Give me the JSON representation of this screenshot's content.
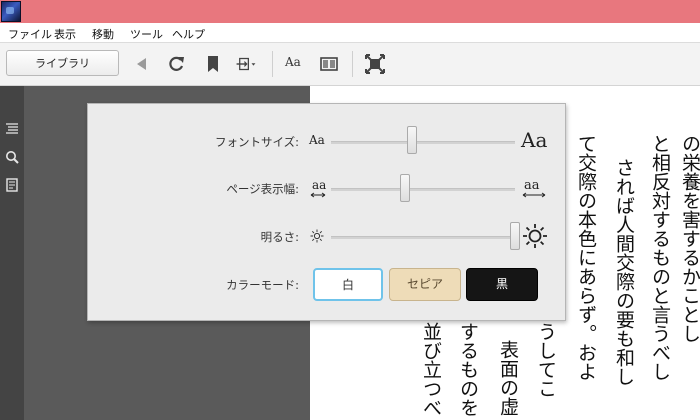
{
  "menu": [
    "ファイル",
    "表示",
    "移動",
    "ツール",
    "ヘルプ"
  ],
  "toolbar": {
    "library_label": "ライブラリ",
    "font_button": "Aa"
  },
  "settings": {
    "font_size": {
      "label": "フォントサイズ:",
      "min_glyph": "Aa",
      "max_glyph": "Aa",
      "level": 0.44
    },
    "page_width": {
      "label": "ページ表示幅:",
      "min_glyph": "aa",
      "max_glyph": "aa",
      "level": 0.4
    },
    "brightness": {
      "label": "明るさ:",
      "level": 1.0
    },
    "color_mode": {
      "label": "カラーモード:",
      "options": [
        "白",
        "セピア",
        "黒"
      ],
      "selected": "白"
    }
  },
  "page_text": {
    "columns": [
      "の栄養を害するかことし",
      "と相反対するものと言うべし",
      "されば人間交際の要も和し",
      "て交際の本色にあらず。およ",
      "うしてこ",
      "表面の虚",
      "するものを",
      "並び立つべ"
    ]
  },
  "colors": {
    "titlebar": "#e8777e",
    "selected_border": "#6fc3ea",
    "sepia": "#eedcb8",
    "black": "#151515"
  }
}
